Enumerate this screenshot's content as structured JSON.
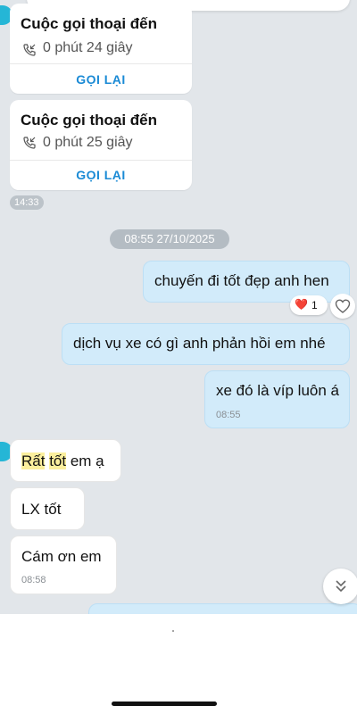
{
  "calls": [
    {
      "title": "Cuộc gọi thoại đến",
      "duration": "0 phút 24 giây",
      "action": "GỌI LẠI"
    },
    {
      "title": "Cuộc gọi thoại đến",
      "duration": "0 phút 25 giây",
      "action": "GỌI LẠI"
    }
  ],
  "call_time": "14:33",
  "date_separator": "08:55 27/10/2025",
  "outgoing": [
    {
      "text": "chuyến đi tốt đẹp anh hen"
    },
    {
      "text": "dịch vụ xe có gì anh phản hồi em nhé"
    },
    {
      "text": "xe đó là víp luôn á",
      "time": "08:55"
    }
  ],
  "reaction": {
    "emoji": "❤️",
    "count": "1",
    "icon": "heart-outline-icon"
  },
  "incoming": [
    {
      "parts": [
        "Rất",
        "tốt",
        "em ạ"
      ]
    },
    {
      "text": "LX tốt"
    },
    {
      "text": "Cám ơn em",
      "time": "08:58"
    }
  ],
  "icons": {
    "call": "incoming-call-icon",
    "scroll": "double-chevron-down-icon"
  },
  "colors": {
    "outgoing_bubble": "#d2ebfa",
    "chat_background": "#e2e6ea",
    "accent": "#1a8ad5",
    "highlight": "#fbef9d"
  }
}
